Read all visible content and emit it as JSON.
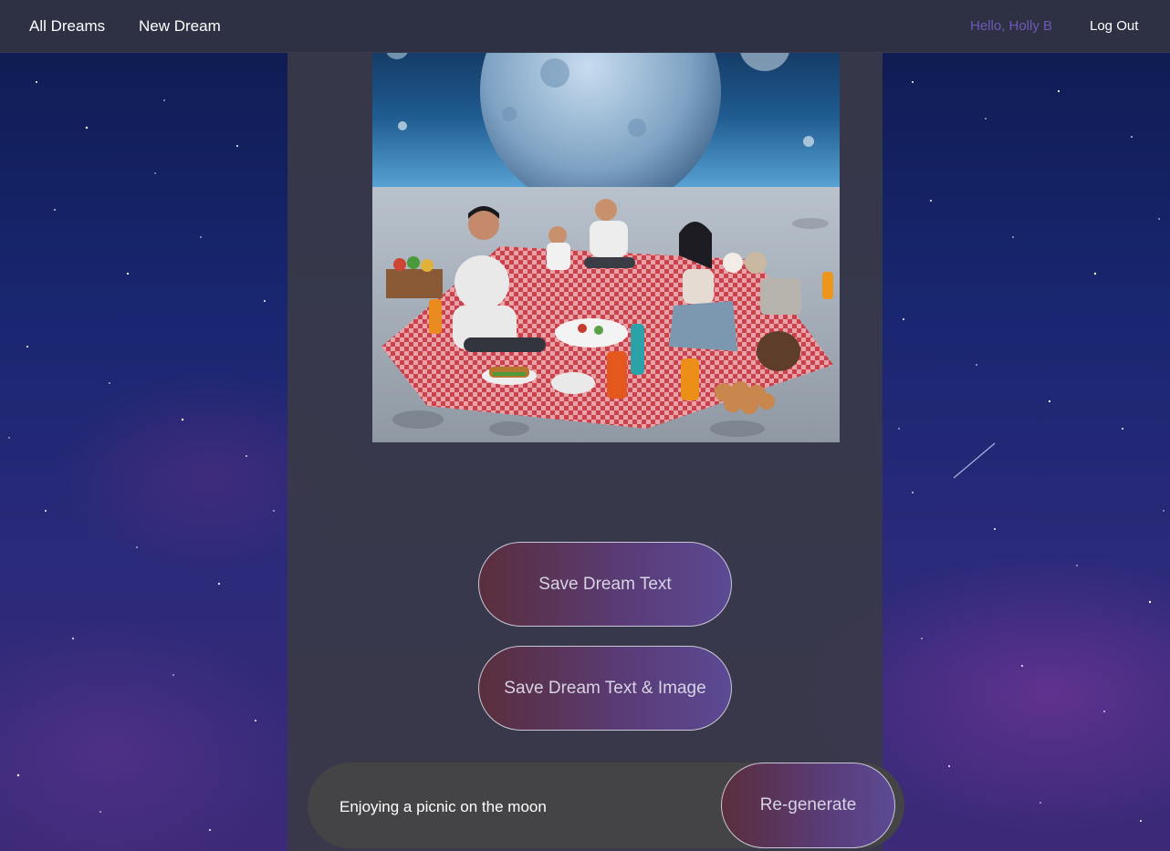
{
  "nav": {
    "all_dreams": "All Dreams",
    "new_dream": "New Dream",
    "greeting": "Hello, Holly B",
    "logout": "Log Out"
  },
  "dream": {
    "image_icon": "moon-picnic-illustration",
    "save_text_label": "Save Dream Text",
    "save_text_image_label": "Save Dream Text & Image"
  },
  "prompt": {
    "text": "Enjoying a picnic on the moon",
    "regenerate_label": "Re-generate"
  },
  "colors": {
    "accent_purple": "#6e58b8",
    "button_start": "#5a2e3c",
    "button_end": "#5b4a94",
    "panel": "#3a3a48",
    "nav": "#2e3144"
  }
}
